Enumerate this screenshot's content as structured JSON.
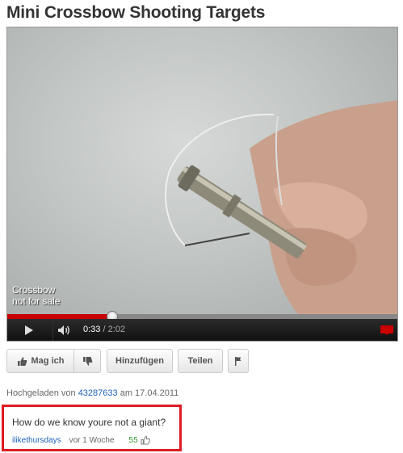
{
  "title": "Mini Crossbow Shooting Targets",
  "video": {
    "overlay_line1": "Crossbow",
    "overlay_line2": "not for sale",
    "progress": 0.27,
    "buffered": 1.0
  },
  "controls": {
    "current_time": "0:33",
    "separator": " / ",
    "total_time": "2:02"
  },
  "actions": {
    "like_label": "Mag ich",
    "add_label": "Hinzufügen",
    "share_label": "Teilen"
  },
  "upload": {
    "prefix": "Hochgeladen von ",
    "uploader_views": "43287633",
    "suffix": " am 17.04.2011"
  },
  "comment": {
    "text": "How do we know youre not a giant?",
    "user": "ilikethursdays",
    "when": "vor 1 Woche",
    "score": "55"
  },
  "colors": {
    "progress_played": "#c80000",
    "highlight_border": "#e01b24",
    "link": "#1c62b9",
    "score": "#339933"
  },
  "icons": [
    "play-icon",
    "volume-icon",
    "fullscreen-icon",
    "thumbs-up-icon",
    "thumbs-down-icon",
    "flag-icon"
  ]
}
